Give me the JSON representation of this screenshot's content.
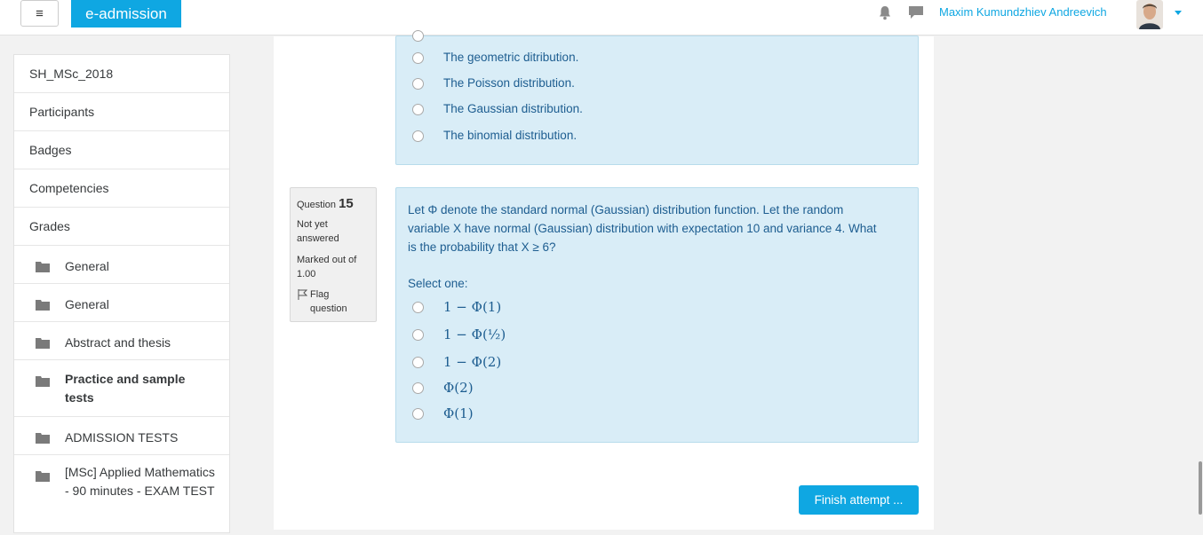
{
  "navbar": {
    "brand": "e-admission",
    "menu_icon": "≡",
    "username": "Maxim Kumundzhiev Andreevich"
  },
  "sidebar": {
    "items": [
      {
        "label": "SH_MSc_2018"
      },
      {
        "label": "Participants"
      },
      {
        "label": "Badges"
      },
      {
        "label": "Competencies"
      },
      {
        "label": "Grades"
      },
      {
        "label": "General"
      },
      {
        "label": "General"
      },
      {
        "label": "Abstract and thesis"
      },
      {
        "label": "Practice and sample tests"
      },
      {
        "label": "ADMISSION TESTS"
      },
      {
        "label": "[MSc] Applied Mathematics - 90 minutes - EXAM TEST"
      }
    ]
  },
  "question14": {
    "options": [
      "The geometric ditribution.",
      "The Poisson distribution.",
      "The Gaussian distribution.",
      "The binomial distribution."
    ]
  },
  "question15": {
    "label": "Question",
    "number": "15",
    "status": "Not yet answered",
    "marked_out_of": "Marked out of 1.00",
    "flag": "Flag question",
    "text_line1": "Let Φ denote the standard normal (Gaussian) distribution function. Let the random",
    "text_line2": "variable X have normal (Gaussian) distribution with expectation 10 and variance 4. What",
    "text_line3": "is the probability that X ≥ 6?",
    "select_one": "Select one:",
    "options": [
      "1 − Φ(1)",
      "1 − Φ(½)",
      "1 − Φ(2)",
      "Φ(2)",
      "Φ(1)"
    ]
  },
  "finish_button": "Finish attempt ..."
}
